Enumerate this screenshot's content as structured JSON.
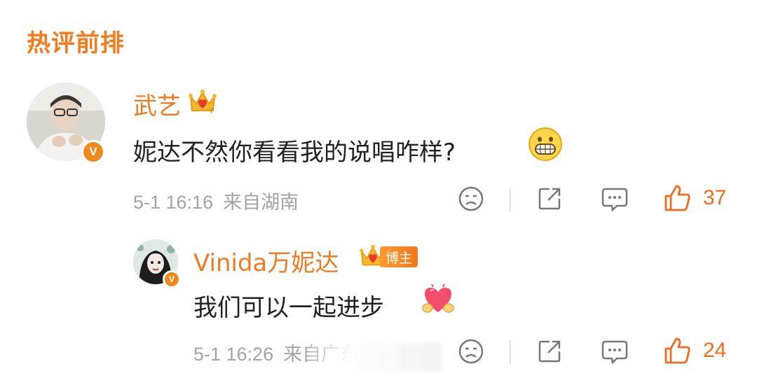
{
  "section": {
    "title": "热评前排"
  },
  "comment": {
    "username": "武艺",
    "text": "妮达不然你看看我的说唱咋样?",
    "emoji": "grin-emoji",
    "time": "5-1 16:16",
    "location": "来自湖南",
    "likes": "37"
  },
  "reply": {
    "username": "Vinida万妮达",
    "role": "博主",
    "text": "我们可以一起进步",
    "emoji": "heart-hands-emoji",
    "time": "5-1 16:26",
    "location": "来自广东",
    "likes": "24"
  },
  "colors": {
    "accent": "#f07a21",
    "like": "#f06a1f",
    "meta": "#a3a3a3",
    "text": "#222222"
  }
}
